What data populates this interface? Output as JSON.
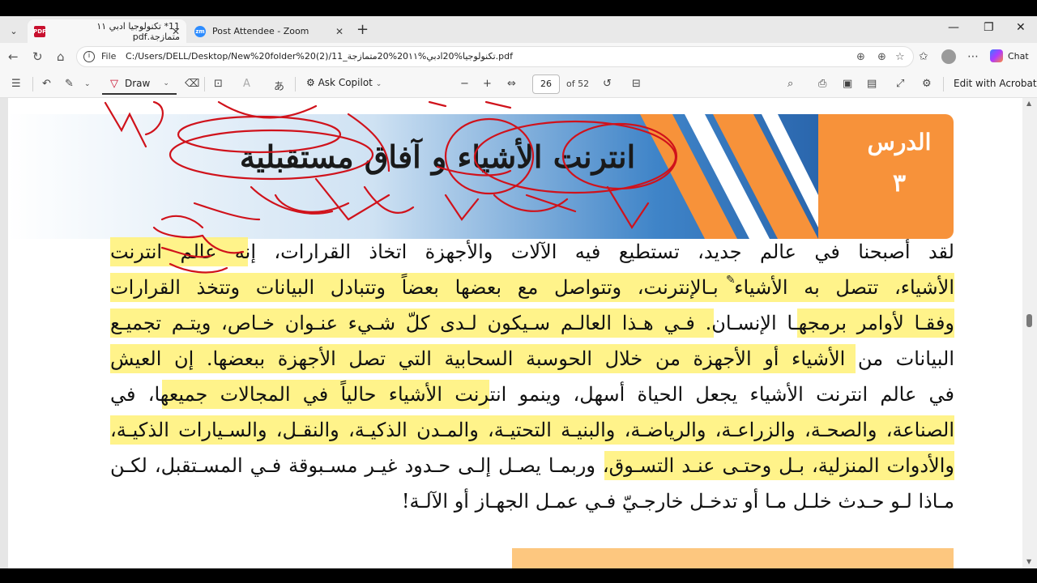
{
  "browser": {
    "tabs": [
      {
        "label": "11* تكنولوجيا ادبي ١١ متمازجة.pdf",
        "active": true
      },
      {
        "label": "Post Attendee - Zoom",
        "active": false
      }
    ],
    "address": {
      "scheme_label": "File",
      "url": "C:/Users/DELL/Desktop/New%20folder%20(2)/11_تكنولوجيا%20ادبي%20١١%20متمازجة.pdf"
    },
    "chat_label": "Chat"
  },
  "pdf_toolbar": {
    "draw_label": "Draw",
    "copilot_label": "Ask Copilot",
    "page_current": "26",
    "page_total": "of 52",
    "edit_label": "Edit with Acrobat"
  },
  "page": {
    "lesson_label": "الدرس",
    "lesson_number": "٣",
    "title": "انترنت الأشياء و آفاق مستقبلية",
    "paragraph_lines": [
      "لقد أصبحنا في عالم جديد، تستطيع فيه الآلات والأجهزة اتخاذ القرارات، إنه عالم انترنت",
      "الأشياء، تتصل به الأشياء بـالإنترنت، وتتواصل مع بعضها بعضاً وتتبادل البيانات وتتخذ القرارات",
      "وفقـا لأوامر برمجهـا الإنسـان. فـي هـذا العالـم سـيكون لـدى كلّ شـيء عنـوان خـاص، ويتـم تجميـع",
      "البيانات من الأشياء أو الأجهزة من خلال الحوسبة السحابية التي تصل الأجهزة ببعضها. إن العيش",
      "في عالم انترنت الأشياء يجعل الحياة أسهل، وينمو انترنت الأشياء حالياً في المجالات جميعها، في",
      "الصناعة، والصحـة، والزراعـة، والرياضـة، والبنيـة التحتيـة، والمـدن الذكيـة، والنقـل، والسـيارات الذكيـة،",
      "والأدوات المنزلية، بـل وحتـى عنـد التسـوق، وربمـا يصـل إلـى حـدود غيـر مسـبوقة فـي المسـتقبل، لكـن",
      "مـاذا لـو حـدث خلـل مـا أو تدخـل خارجـيّ فـي عمـل الجهـاز أو الآلـة!"
    ]
  },
  "colors": {
    "highlight": "#fff176",
    "lesson_orange": "#f7923a",
    "banner_blue": "#2f6db5",
    "ink_red": "#d0121b"
  }
}
